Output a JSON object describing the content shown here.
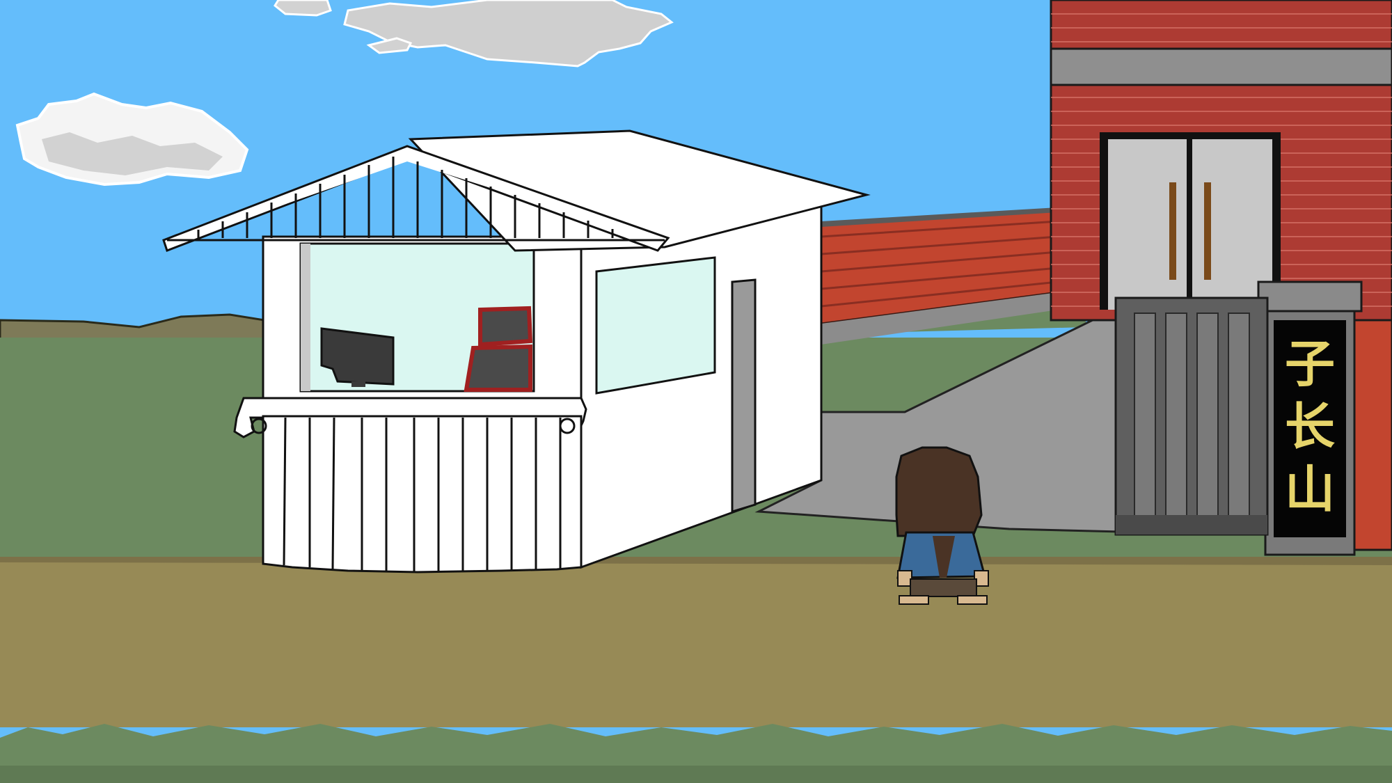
{
  "scene": {
    "sign": {
      "glyphs": [
        "子",
        "长",
        "山"
      ],
      "text_color": "#e6d46a",
      "background_color": "#050505"
    },
    "colors": {
      "sky": "#64bdfb",
      "cloud": "#f2f2f2",
      "cloud_shade": "#cfcfcf",
      "grass": "#6c8a60",
      "grass_dark": "#5f7a54",
      "dirt_path": "#978a56",
      "hills": "#7e7a58",
      "booth": "#ffffff",
      "booth_window": "#daf7f1",
      "brick": "#ad3b33",
      "brick_wall": "#c2452f",
      "concrete": "#999999",
      "gate_metal": "#5f5f5f",
      "character_hair": "#4a3325",
      "character_shirt": "#3a6a9a",
      "character_skin": "#d8b990"
    },
    "icons": {
      "computer": "monitor-icon",
      "register": "cash-register-icon"
    }
  }
}
